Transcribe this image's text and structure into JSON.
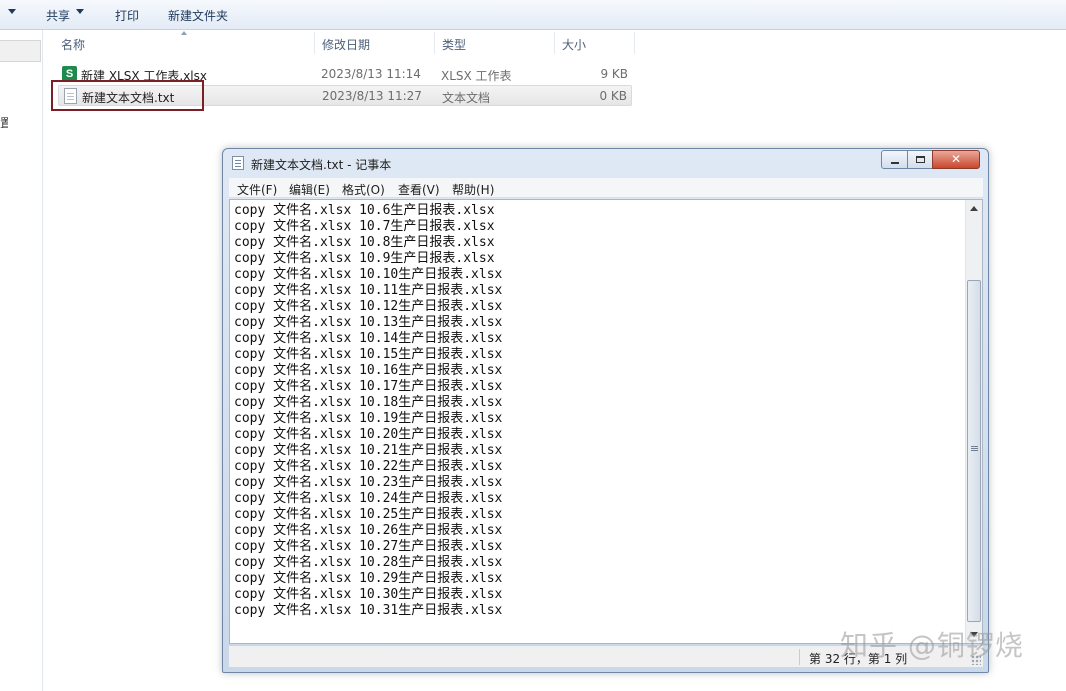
{
  "toolbar": {
    "share": "共享",
    "print": "打印",
    "new_folder": "新建文件夹"
  },
  "nav": {
    "glyph": "置"
  },
  "columns": {
    "name": "名称",
    "modified": "修改日期",
    "type": "类型",
    "size": "大小"
  },
  "files": [
    {
      "icon": "xlsx-file-icon",
      "icon_glyph": "S",
      "name": "新建 XLSX 工作表.xlsx",
      "modified": "2023/8/13 11:14",
      "type": "XLSX 工作表",
      "size": "9 KB"
    },
    {
      "icon": "txt-file-icon",
      "name": "新建文本文档.txt",
      "modified": "2023/8/13 11:27",
      "type": "文本文档",
      "size": "0 KB",
      "selected": true
    }
  ],
  "notepad": {
    "title": "新建文本文档.txt - 记事本",
    "close_glyph": "✕",
    "menu": {
      "file": "文件(F)",
      "edit": "编辑(E)",
      "format": "格式(O)",
      "view": "查看(V)",
      "help": "帮助(H)"
    },
    "content": "copy 文件名.xlsx 10.6生产日报表.xlsx\ncopy 文件名.xlsx 10.7生产日报表.xlsx\ncopy 文件名.xlsx 10.8生产日报表.xlsx\ncopy 文件名.xlsx 10.9生产日报表.xlsx\ncopy 文件名.xlsx 10.10生产日报表.xlsx\ncopy 文件名.xlsx 10.11生产日报表.xlsx\ncopy 文件名.xlsx 10.12生产日报表.xlsx\ncopy 文件名.xlsx 10.13生产日报表.xlsx\ncopy 文件名.xlsx 10.14生产日报表.xlsx\ncopy 文件名.xlsx 10.15生产日报表.xlsx\ncopy 文件名.xlsx 10.16生产日报表.xlsx\ncopy 文件名.xlsx 10.17生产日报表.xlsx\ncopy 文件名.xlsx 10.18生产日报表.xlsx\ncopy 文件名.xlsx 10.19生产日报表.xlsx\ncopy 文件名.xlsx 10.20生产日报表.xlsx\ncopy 文件名.xlsx 10.21生产日报表.xlsx\ncopy 文件名.xlsx 10.22生产日报表.xlsx\ncopy 文件名.xlsx 10.23生产日报表.xlsx\ncopy 文件名.xlsx 10.24生产日报表.xlsx\ncopy 文件名.xlsx 10.25生产日报表.xlsx\ncopy 文件名.xlsx 10.26生产日报表.xlsx\ncopy 文件名.xlsx 10.27生产日报表.xlsx\ncopy 文件名.xlsx 10.28生产日报表.xlsx\ncopy 文件名.xlsx 10.29生产日报表.xlsx\ncopy 文件名.xlsx 10.30生产日报表.xlsx\ncopy 文件名.xlsx 10.31生产日报表.xlsx",
    "status": "第 32 行，第 1 列"
  },
  "watermark": "知乎 @铜锣烧",
  "colors": {
    "highlight_border": "#7a1f27",
    "xlsx_icon": "#1e8a4c",
    "close_button": "#c9462c"
  }
}
